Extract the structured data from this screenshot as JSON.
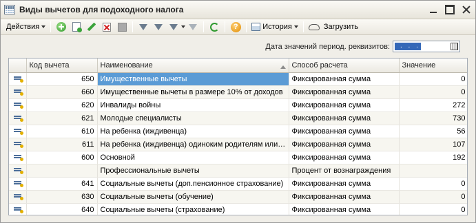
{
  "window": {
    "title": "Виды вычетов для подоходного налога",
    "buttons": [
      "minimize",
      "maximize",
      "close"
    ]
  },
  "toolbar": {
    "actions_label": "Действия",
    "history_label": "История",
    "load_label": "Загрузить",
    "help_glyph": "?"
  },
  "date_row": {
    "label": "Дата значений период. реквизитов:",
    "value": ". . ."
  },
  "table": {
    "columns": [
      "Код вычета",
      "Наименование",
      "Способ расчета",
      "Значение"
    ],
    "rows": [
      {
        "code": "650",
        "name": "Имущественные вычеты",
        "method": "Фиксированная сумма",
        "value": "0"
      },
      {
        "code": "660",
        "name": "Имущественные вычеты в размере 10% от доходов",
        "method": "Фиксированная сумма",
        "value": "0"
      },
      {
        "code": "620",
        "name": "Инвалиды войны",
        "method": "Фиксированная сумма",
        "value": "272"
      },
      {
        "code": "621",
        "name": "Молодые специалисты",
        "method": "Фиксированная сумма",
        "value": "730"
      },
      {
        "code": "610",
        "name": "На ребенка (иждивенца)",
        "method": "Фиксированная сумма",
        "value": "56"
      },
      {
        "code": "611",
        "name": "На ребенка (иждивенца) одиноким родителям или и...",
        "method": "Фиксированная сумма",
        "value": "107"
      },
      {
        "code": "600",
        "name": "Основной",
        "method": "Фиксированная сумма",
        "value": "192"
      },
      {
        "code": "",
        "name": "Профессиональные вычеты",
        "method": "Процент от вознаграждения",
        "value": ""
      },
      {
        "code": "641",
        "name": "Социальные вычеты (доп.пенсионное страхование)",
        "method": "Фиксированная сумма",
        "value": "0"
      },
      {
        "code": "630",
        "name": "Социальные вычеты (обучение)",
        "method": "Фиксированная сумма",
        "value": "0"
      },
      {
        "code": "640",
        "name": "Социальные вычеты (страхование)",
        "method": "Фиксированная сумма",
        "value": "0"
      }
    ]
  }
}
